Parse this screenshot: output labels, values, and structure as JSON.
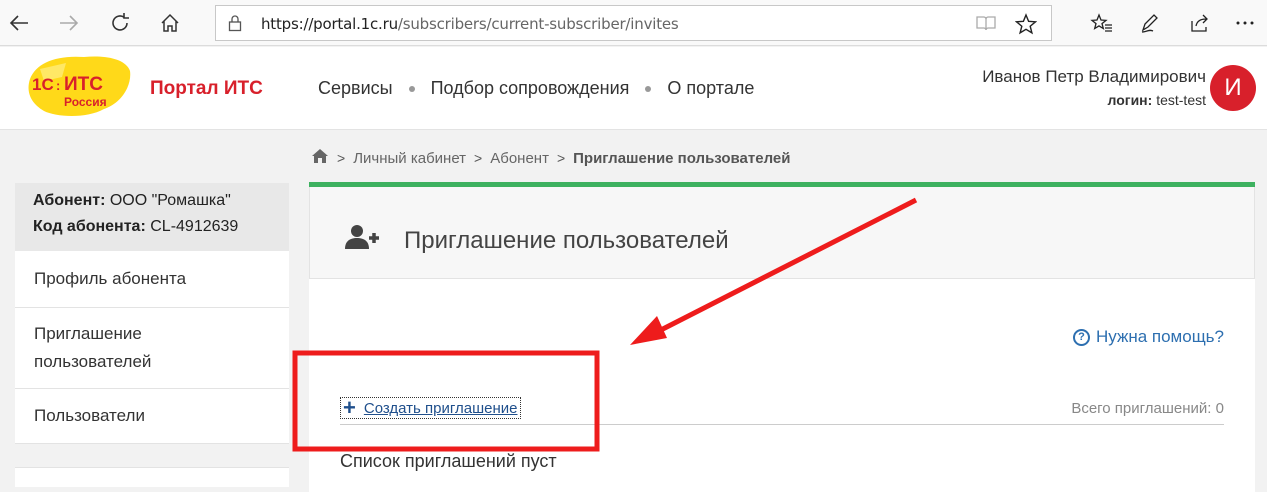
{
  "browser": {
    "url_main": "https://portal.1c.ru",
    "url_path": "/subscribers/current-subscriber/invites",
    "icons": [
      "back-icon",
      "forward-icon",
      "refresh-icon",
      "home-icon",
      "lock-icon",
      "reading-view-icon",
      "favorite-star-icon",
      "favorites-icon",
      "pen-icon",
      "share-icon",
      "more-icon"
    ]
  },
  "header": {
    "logo_text": "1С:ИТС Россия",
    "portal_title": "Портал ИТС",
    "nav": [
      "Сервисы",
      "Подбор сопровождения",
      "О портале"
    ],
    "user_name": "Иванов Петр Владимирович",
    "login_label": "логин:",
    "login_value": "test-test",
    "avatar_letter": "И",
    "brand_color": "#d8202b"
  },
  "breadcrumb": {
    "items": [
      "Личный кабинет",
      "Абонент"
    ],
    "current": "Приглашение пользователей"
  },
  "sidebar": {
    "subscriber_label": "Абонент:",
    "subscriber_value": "ООО \"Ромашка\"",
    "code_label": "Код абонента:",
    "code_value": "CL-4912639",
    "items": [
      {
        "label": "Профиль абонента"
      },
      {
        "label": "Приглашение пользователей"
      },
      {
        "label": "Пользователи"
      }
    ]
  },
  "main": {
    "title": "Приглашение пользователей",
    "help_label": "Нужна помощь?",
    "create_label": "Создать приглашение",
    "total_label": "Всего приглашений: 0",
    "empty_label": "Список приглашений пуст",
    "accent_color": "#3db15f"
  }
}
